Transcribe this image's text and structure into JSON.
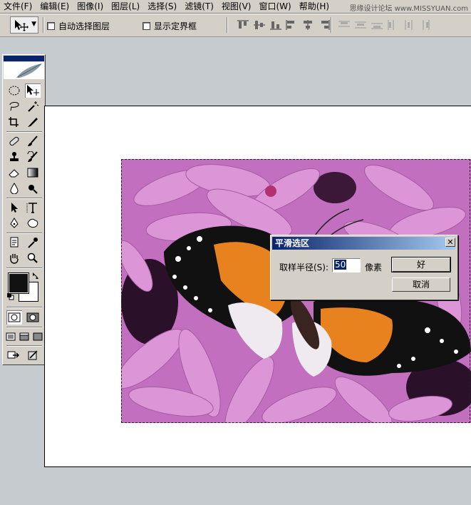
{
  "menu": [
    {
      "label": "文件(F)"
    },
    {
      "label": "编辑(E)"
    },
    {
      "label": "图像(I)"
    },
    {
      "label": "图层(L)"
    },
    {
      "label": "选择(S)"
    },
    {
      "label": "滤镜(T)"
    },
    {
      "label": "视图(V)"
    },
    {
      "label": "窗口(W)"
    },
    {
      "label": "帮助(H)"
    }
  ],
  "watermark": "思缘设计论坛 www.MISSYUAN.com",
  "options": {
    "auto_select_layer": "自动选择图层",
    "show_bounding_box": "显示定界框"
  },
  "dialog": {
    "title": "平滑选区",
    "radius_label": "取样半径(S):",
    "radius_value": "50",
    "radius_unit": "像素",
    "ok_label": "好",
    "cancel_label": "取消"
  },
  "colors": {
    "title_bar": "#0a246a",
    "chrome": "#d4d0c8",
    "workspace": "#c5cbce",
    "petal": "#c872c4",
    "butterfly_orange": "#e8821e"
  }
}
